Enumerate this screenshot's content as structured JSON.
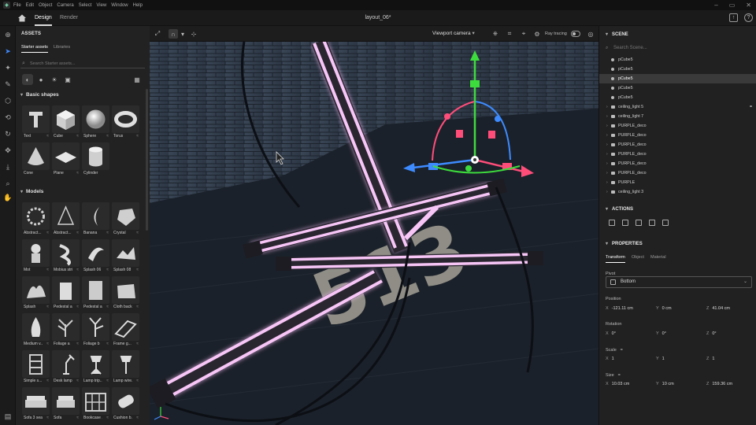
{
  "menubar": {
    "items": [
      "File",
      "Edit",
      "Object",
      "Camera",
      "Select",
      "View",
      "Window",
      "Help"
    ]
  },
  "topbar": {
    "tabs": [
      "Design",
      "Render"
    ],
    "doc_title": "layout_06*"
  },
  "assets": {
    "title": "ASSETS",
    "tabs": [
      "Starter assets",
      "Libraries"
    ],
    "search_placeholder": "Search Starter assets...",
    "sections": {
      "basic": "Basic shapes",
      "models": "Models"
    },
    "basic_shapes": [
      "Text",
      "Cube",
      "Sphere",
      "Torus",
      "Cone",
      "Plane",
      "Cylinder"
    ],
    "models": [
      "Abstract...",
      "Abstract...",
      "Banana",
      "Crystal",
      "Mot",
      "Mobius strip",
      "Splash 06",
      "Splash 08",
      "Splash",
      "Pedestal a...",
      "Pedestal a...",
      "Cloth back...",
      "Medium v...",
      "Foliage a",
      "Foliage b",
      "Frame g...",
      "Simple s...",
      "Desk lamp",
      "Lamp trip...",
      "Lamp wire...",
      "Sofa 3 seats",
      "Sofa",
      "Bookcase ...",
      "Cushion b..."
    ]
  },
  "viewport": {
    "camera": "Viewport camera",
    "ray_tracing": "Ray tracing",
    "floor_number": "513"
  },
  "scene": {
    "title": "SCENE",
    "search_placeholder": "Search Scene...",
    "items": [
      {
        "name": "pCube5",
        "type": "obj",
        "selected": false
      },
      {
        "name": "pCube5",
        "type": "obj",
        "selected": false
      },
      {
        "name": "pCube5",
        "type": "obj",
        "selected": true
      },
      {
        "name": "pCube5",
        "type": "obj",
        "selected": false
      },
      {
        "name": "pCube5",
        "type": "obj",
        "selected": false
      },
      {
        "name": "ceiling_light 5",
        "type": "folder",
        "selected": false
      },
      {
        "name": "ceiling_light 7",
        "type": "folder",
        "selected": false
      },
      {
        "name": "PURPLE_deco",
        "type": "folder",
        "selected": false
      },
      {
        "name": "PURPLE_deco",
        "type": "folder",
        "selected": false
      },
      {
        "name": "PURPLE_deco",
        "type": "folder",
        "selected": false
      },
      {
        "name": "PURPLE_deco",
        "type": "folder",
        "selected": false
      },
      {
        "name": "PURPLE_deco",
        "type": "folder",
        "selected": false
      },
      {
        "name": "PURPLE_deco",
        "type": "folder",
        "selected": false
      },
      {
        "name": "PURPLE",
        "type": "folder",
        "selected": false
      },
      {
        "name": "ceiling_light 3",
        "type": "folder",
        "selected": false
      }
    ]
  },
  "actions": {
    "title": "ACTIONS"
  },
  "properties": {
    "title": "PROPERTIES",
    "tabs": [
      "Transform",
      "Object",
      "Material"
    ],
    "pivot_label": "Pivot",
    "pivot_value": "Bottom",
    "position_label": "Position",
    "position": {
      "x": "-121.11 cm",
      "y": "0 cm",
      "z": "41.04 cm"
    },
    "rotation_label": "Rotation",
    "rotation": {
      "x": "0°",
      "y": "0°",
      "z": "0°"
    },
    "scale_label": "Scale",
    "scale": {
      "x": "1",
      "y": "1",
      "z": "1"
    },
    "size_label": "Size",
    "size": {
      "x": "10.03 cm",
      "y": "10 cm",
      "z": "159.36 cm"
    }
  },
  "colors": {
    "accent": "#3d8bff",
    "neon": "#f0b8f0",
    "gizmo_green": "#3ddc3d",
    "gizmo_pink": "#ff4d7a",
    "gizmo_blue": "#3d8bff"
  }
}
